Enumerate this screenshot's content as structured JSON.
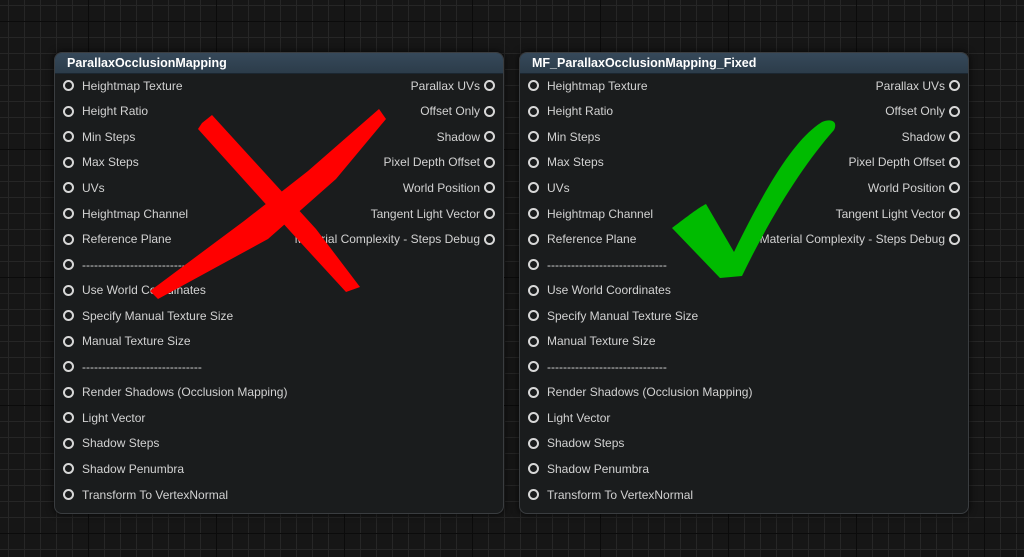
{
  "nodes": [
    {
      "title": "ParallaxOcclusionMapping",
      "inputs": [
        "Heightmap Texture",
        "Height Ratio",
        "Min Steps",
        "Max Steps",
        "UVs",
        "Heightmap Channel",
        "Reference Plane",
        "------------------------------",
        "Use World Coordinates",
        "Specify Manual Texture Size",
        "Manual Texture Size",
        "------------------------------",
        "Render Shadows (Occlusion Mapping)",
        "Light Vector",
        "Shadow Steps",
        "Shadow Penumbra",
        "Transform To VertexNormal"
      ],
      "outputs": [
        "Parallax UVs",
        "Offset Only",
        "Shadow",
        "Pixel Depth Offset",
        "World Position",
        "Tangent Light Vector",
        "Material Complexity - Steps Debug"
      ]
    },
    {
      "title": "MF_ParallaxOcclusionMapping_Fixed",
      "inputs": [
        "Heightmap Texture",
        "Height Ratio",
        "Min Steps",
        "Max Steps",
        "UVs",
        "Heightmap Channel",
        "Reference Plane",
        "------------------------------",
        "Use World Coordinates",
        "Specify Manual Texture Size",
        "Manual Texture Size",
        "------------------------------",
        "Render Shadows (Occlusion Mapping)",
        "Light Vector",
        "Shadow Steps",
        "Shadow Penumbra",
        "Transform To VertexNormal"
      ],
      "outputs": [
        "Parallax UVs",
        "Offset Only",
        "Shadow",
        "Pixel Depth Offset",
        "World Position",
        "Tangent Light Vector",
        "Material Complexity - Steps Debug"
      ]
    }
  ],
  "marks": {
    "cross_color": "#ff0000",
    "check_color": "#00bb00"
  }
}
